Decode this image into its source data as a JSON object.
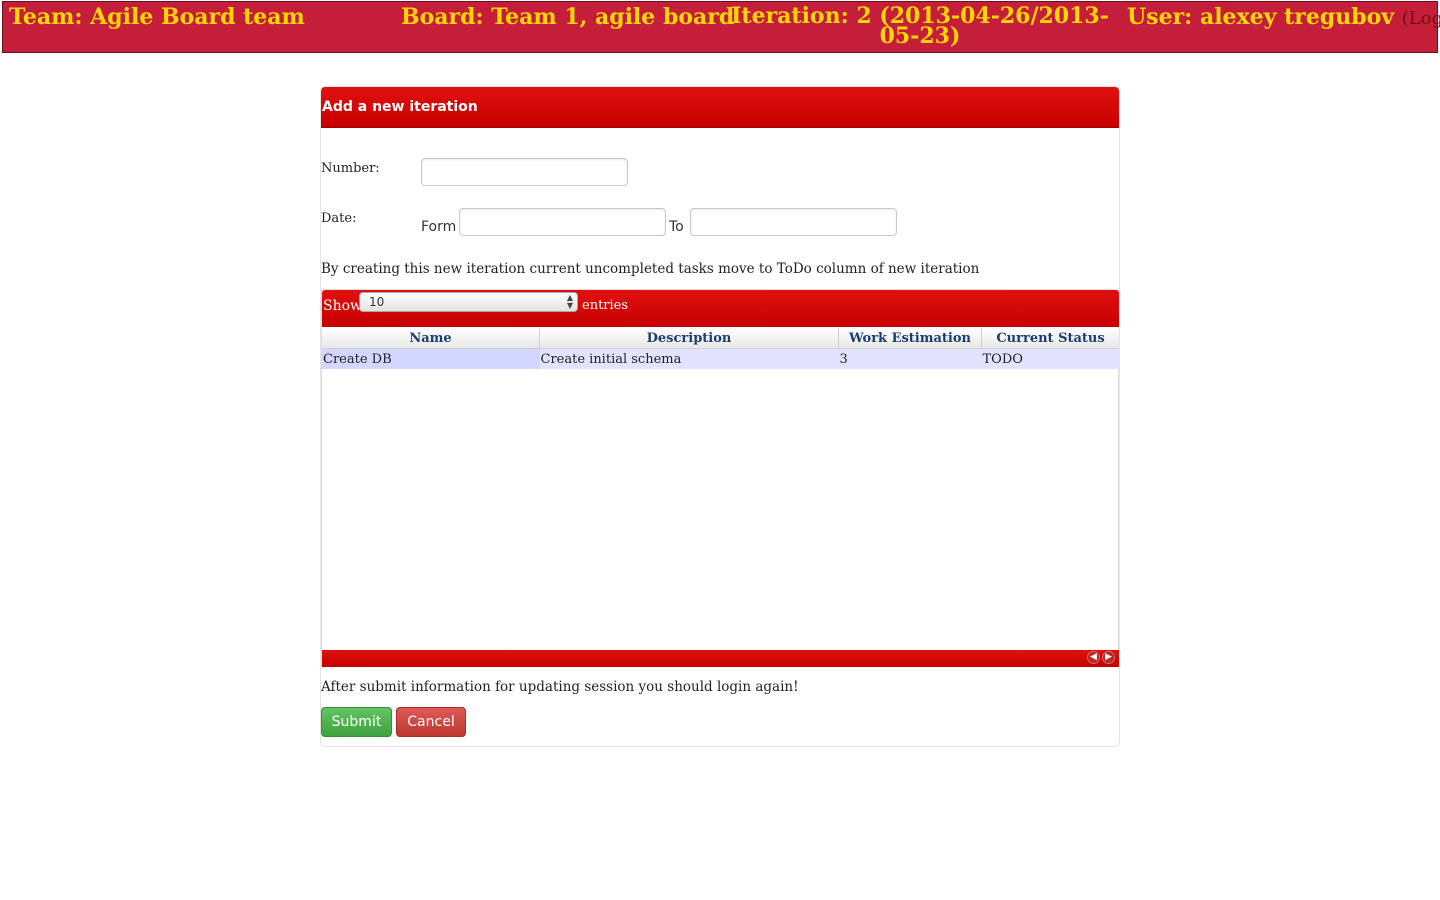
{
  "header": {
    "team": "Team: Agile Board team",
    "board": "Board: Team 1, agile board",
    "iteration": "Iteration: 2 (2013-04-26/2013-05-23)",
    "user": "User: alexey tregubov",
    "logout": "(Logout)"
  },
  "form": {
    "title": "Add a new iteration",
    "number_label": "Number:",
    "number_value": "",
    "date_label": "Date:",
    "from_label": "Form",
    "from_value": "",
    "to_label": "To",
    "to_value": "",
    "info_text": "By creating this new iteration current uncompleted tasks move to ToDo column of new iteration",
    "note_text": "After submit information for updating session you should login again!",
    "submit_label": "Submit",
    "cancel_label": "Cancel"
  },
  "table": {
    "show_label": "Show",
    "page_size": "10",
    "entries_label": "entries",
    "columns": [
      "Name",
      "Description",
      "Work Estimation",
      "Current Status"
    ],
    "rows": [
      [
        "Create DB",
        "Create initial schema",
        "3",
        "TODO"
      ]
    ],
    "prev_icon": "prev-page-icon",
    "next_icon": "next-page-icon"
  },
  "colors": {
    "header_bg": "#c41e3a",
    "header_text": "#ffd700",
    "accent_red": "#d00000",
    "submit_green": "#51a351",
    "cancel_red": "#bd362f"
  }
}
